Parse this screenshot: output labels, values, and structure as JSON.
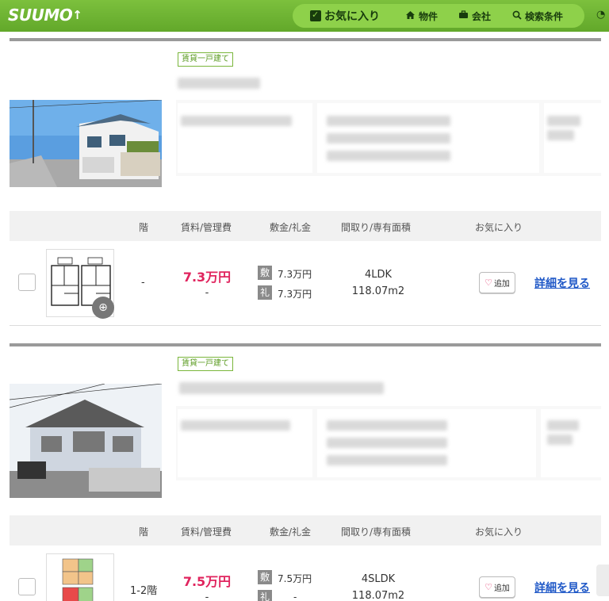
{
  "header": {
    "logo": "SUUMO",
    "nav": {
      "favorites": "お気に入り",
      "properties": "物件",
      "companies": "会社",
      "search_conditions": "検索条件"
    }
  },
  "columns": {
    "floor": "階",
    "rent": "賃料/管理費",
    "deposit": "敷金/礼金",
    "layout": "間取り/専有面積",
    "favorite": "お気に入り"
  },
  "listings": [
    {
      "tag": "賃貸一戸建て",
      "floor": "-",
      "rent": "7.3万円",
      "management": "-",
      "deposit_badge": "敷",
      "deposit": "7.3万円",
      "key_badge": "礼",
      "key_money": "7.3万円",
      "layout": "4LDK",
      "area": "118.07m2",
      "add_label": "追加",
      "detail_label": "詳細を見る"
    },
    {
      "tag": "賃貸一戸建て",
      "floor": "1-2階",
      "rent": "7.5万円",
      "management": "-",
      "deposit_badge": "敷",
      "deposit": "7.5万円",
      "key_badge": "礼",
      "key_money": "-",
      "layout": "4SLDK",
      "area": "118.07m2",
      "add_label": "追加",
      "detail_label": "詳細を見る"
    }
  ]
}
